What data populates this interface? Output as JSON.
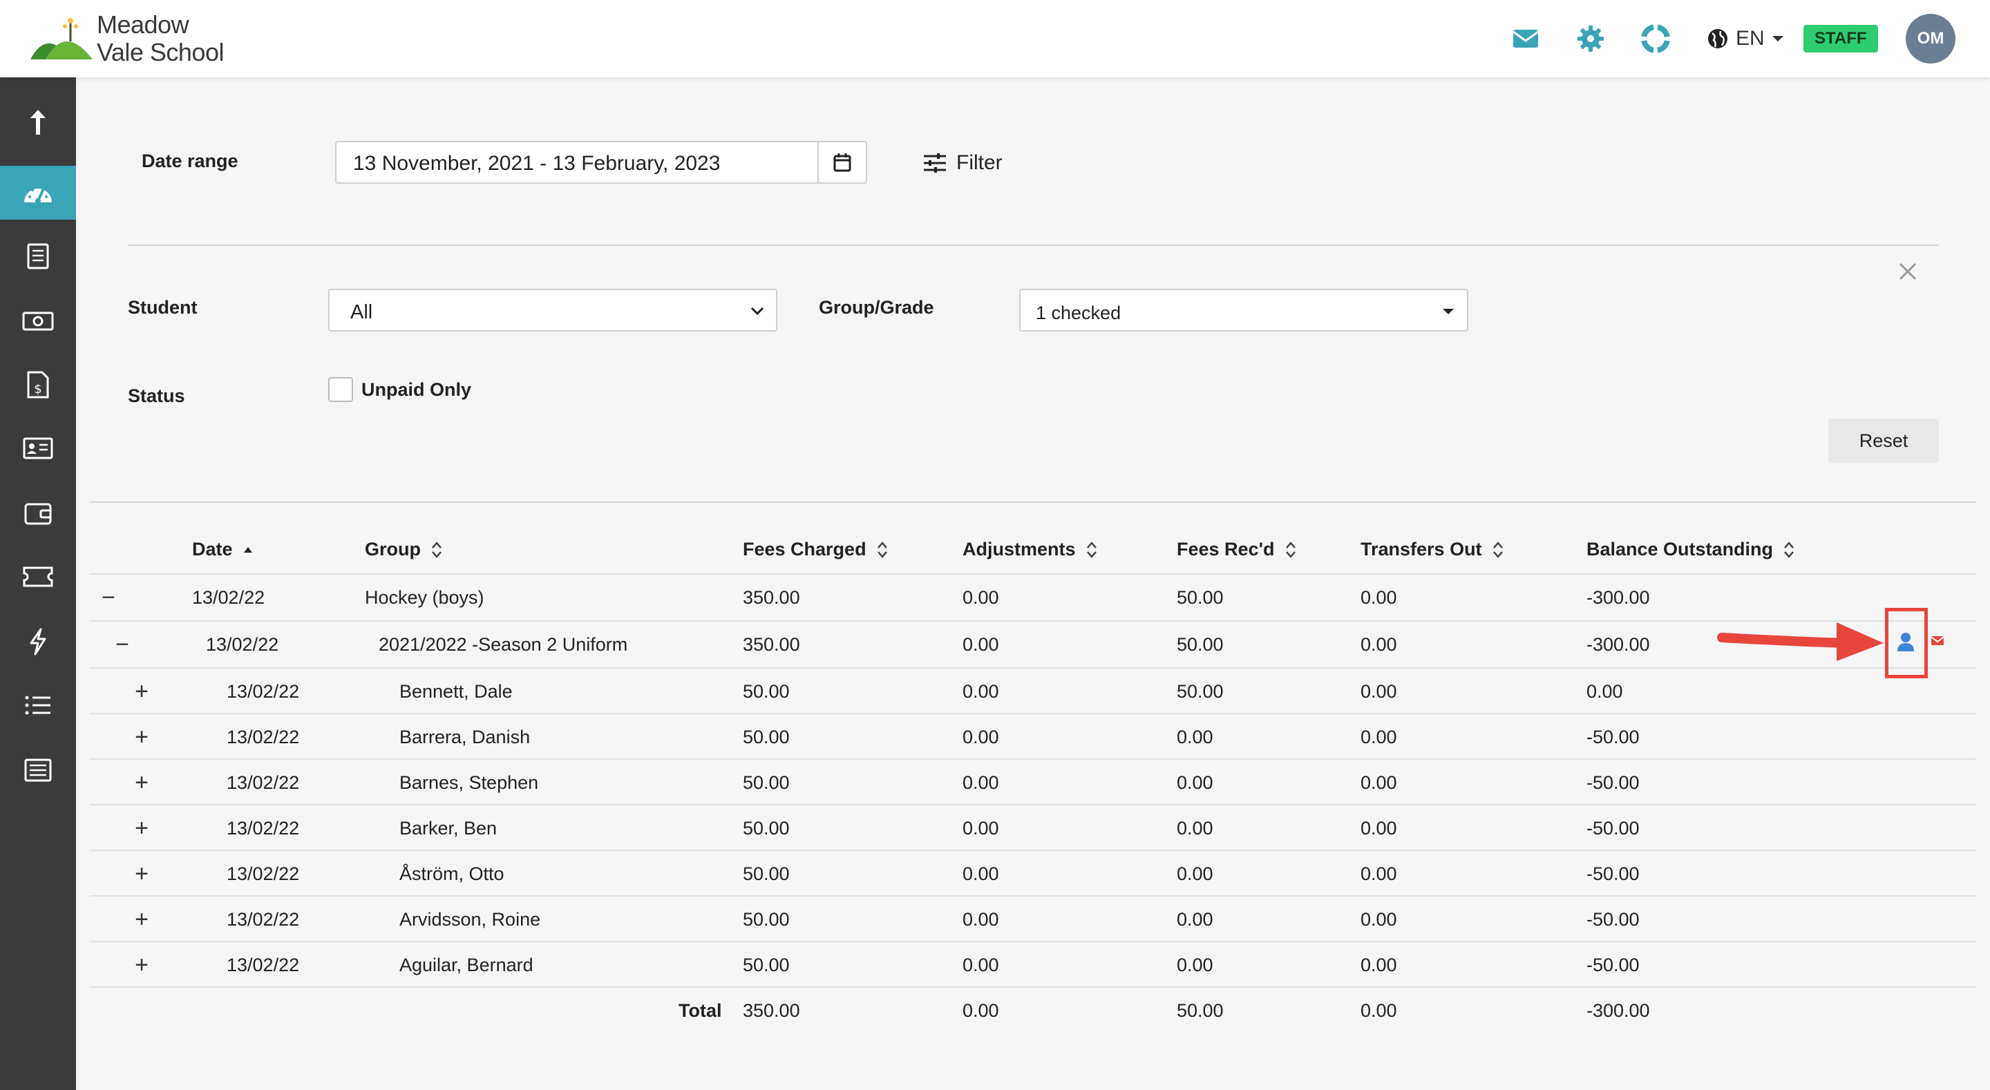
{
  "header": {
    "logo_line1": "Meadow",
    "logo_line2": "Vale School",
    "icons": [
      "mail-icon",
      "gear-icon",
      "lifebuoy-icon",
      "globe-icon"
    ],
    "language": "EN",
    "staff_badge": "STAFF",
    "avatar_initials": "OM"
  },
  "sidebar": {
    "items": [
      {
        "icon": "upload-arrow-icon",
        "active": false
      },
      {
        "icon": "dashboard-gauge-icon",
        "active": true
      },
      {
        "icon": "document-list-icon",
        "active": false
      },
      {
        "icon": "money-icon",
        "active": false
      },
      {
        "icon": "invoice-dollar-icon",
        "active": false
      },
      {
        "icon": "id-card-icon",
        "active": false
      },
      {
        "icon": "wallet-icon",
        "active": false
      },
      {
        "icon": "ticket-icon",
        "active": false
      },
      {
        "icon": "lightning-icon",
        "active": false
      },
      {
        "icon": "bulleted-list-icon",
        "active": false
      },
      {
        "icon": "list-box-icon",
        "active": false
      }
    ]
  },
  "filters": {
    "date_range_label": "Date range",
    "date_range_value": "13 November, 2021 - 13 February, 2023",
    "filter_label": "Filter",
    "student_label": "Student",
    "student_value": "All",
    "group_label": "Group/Grade",
    "group_value": "1 checked",
    "status_label": "Status",
    "unpaid_only_label": "Unpaid Only",
    "reset_label": "Reset"
  },
  "table": {
    "headers": {
      "date": "Date",
      "group": "Group",
      "fees_charged": "Fees Charged",
      "adjustments": "Adjustments",
      "fees_recd": "Fees Rec'd",
      "transfers_out": "Transfers Out",
      "balance": "Balance Outstanding"
    },
    "rows": [
      {
        "toggle": "−",
        "date": "13/02/22",
        "group": "Hockey (boys)",
        "fees_charged": "350.00",
        "adjustments": "0.00",
        "fees_recd": "50.00",
        "transfers_out": "0.00",
        "balance": "-300.00"
      },
      {
        "toggle": "−",
        "date": "13/02/22",
        "group": "2021/2022 -Season 2 Uniform",
        "fees_charged": "350.00",
        "adjustments": "0.00",
        "fees_recd": "50.00",
        "transfers_out": "0.00",
        "balance": "-300.00"
      },
      {
        "toggle": "+",
        "date": "13/02/22",
        "group": "Bennett, Dale",
        "fees_charged": "50.00",
        "adjustments": "0.00",
        "fees_recd": "50.00",
        "transfers_out": "0.00",
        "balance": "0.00"
      },
      {
        "toggle": "+",
        "date": "13/02/22",
        "group": "Barrera, Danish",
        "fees_charged": "50.00",
        "adjustments": "0.00",
        "fees_recd": "0.00",
        "transfers_out": "0.00",
        "balance": "-50.00"
      },
      {
        "toggle": "+",
        "date": "13/02/22",
        "group": "Barnes, Stephen",
        "fees_charged": "50.00",
        "adjustments": "0.00",
        "fees_recd": "0.00",
        "transfers_out": "0.00",
        "balance": "-50.00"
      },
      {
        "toggle": "+",
        "date": "13/02/22",
        "group": "Barker, Ben",
        "fees_charged": "50.00",
        "adjustments": "0.00",
        "fees_recd": "0.00",
        "transfers_out": "0.00",
        "balance": "-50.00"
      },
      {
        "toggle": "+",
        "date": "13/02/22",
        "group": "Åström, Otto",
        "fees_charged": "50.00",
        "adjustments": "0.00",
        "fees_recd": "0.00",
        "transfers_out": "0.00",
        "balance": "-50.00"
      },
      {
        "toggle": "+",
        "date": "13/02/22",
        "group": "Arvidsson, Roine",
        "fees_charged": "50.00",
        "adjustments": "0.00",
        "fees_recd": "0.00",
        "transfers_out": "0.00",
        "balance": "-50.00"
      },
      {
        "toggle": "+",
        "date": "13/02/22",
        "group": "Aguilar, Bernard",
        "fees_charged": "50.00",
        "adjustments": "0.00",
        "fees_recd": "0.00",
        "transfers_out": "0.00",
        "balance": "-50.00"
      }
    ],
    "total": {
      "label": "Total",
      "fees_charged": "350.00",
      "adjustments": "0.00",
      "fees_recd": "50.00",
      "transfers_out": "0.00",
      "balance": "-300.00"
    }
  },
  "annotation": {
    "arrow_color": "#e8453c",
    "highlight_color": "#e8453c"
  },
  "colors": {
    "accent": "#3aa4b8",
    "sidebar": "#3b3b3b",
    "staff_badge": "#2ecc71",
    "link_blue": "#3a86d8"
  }
}
